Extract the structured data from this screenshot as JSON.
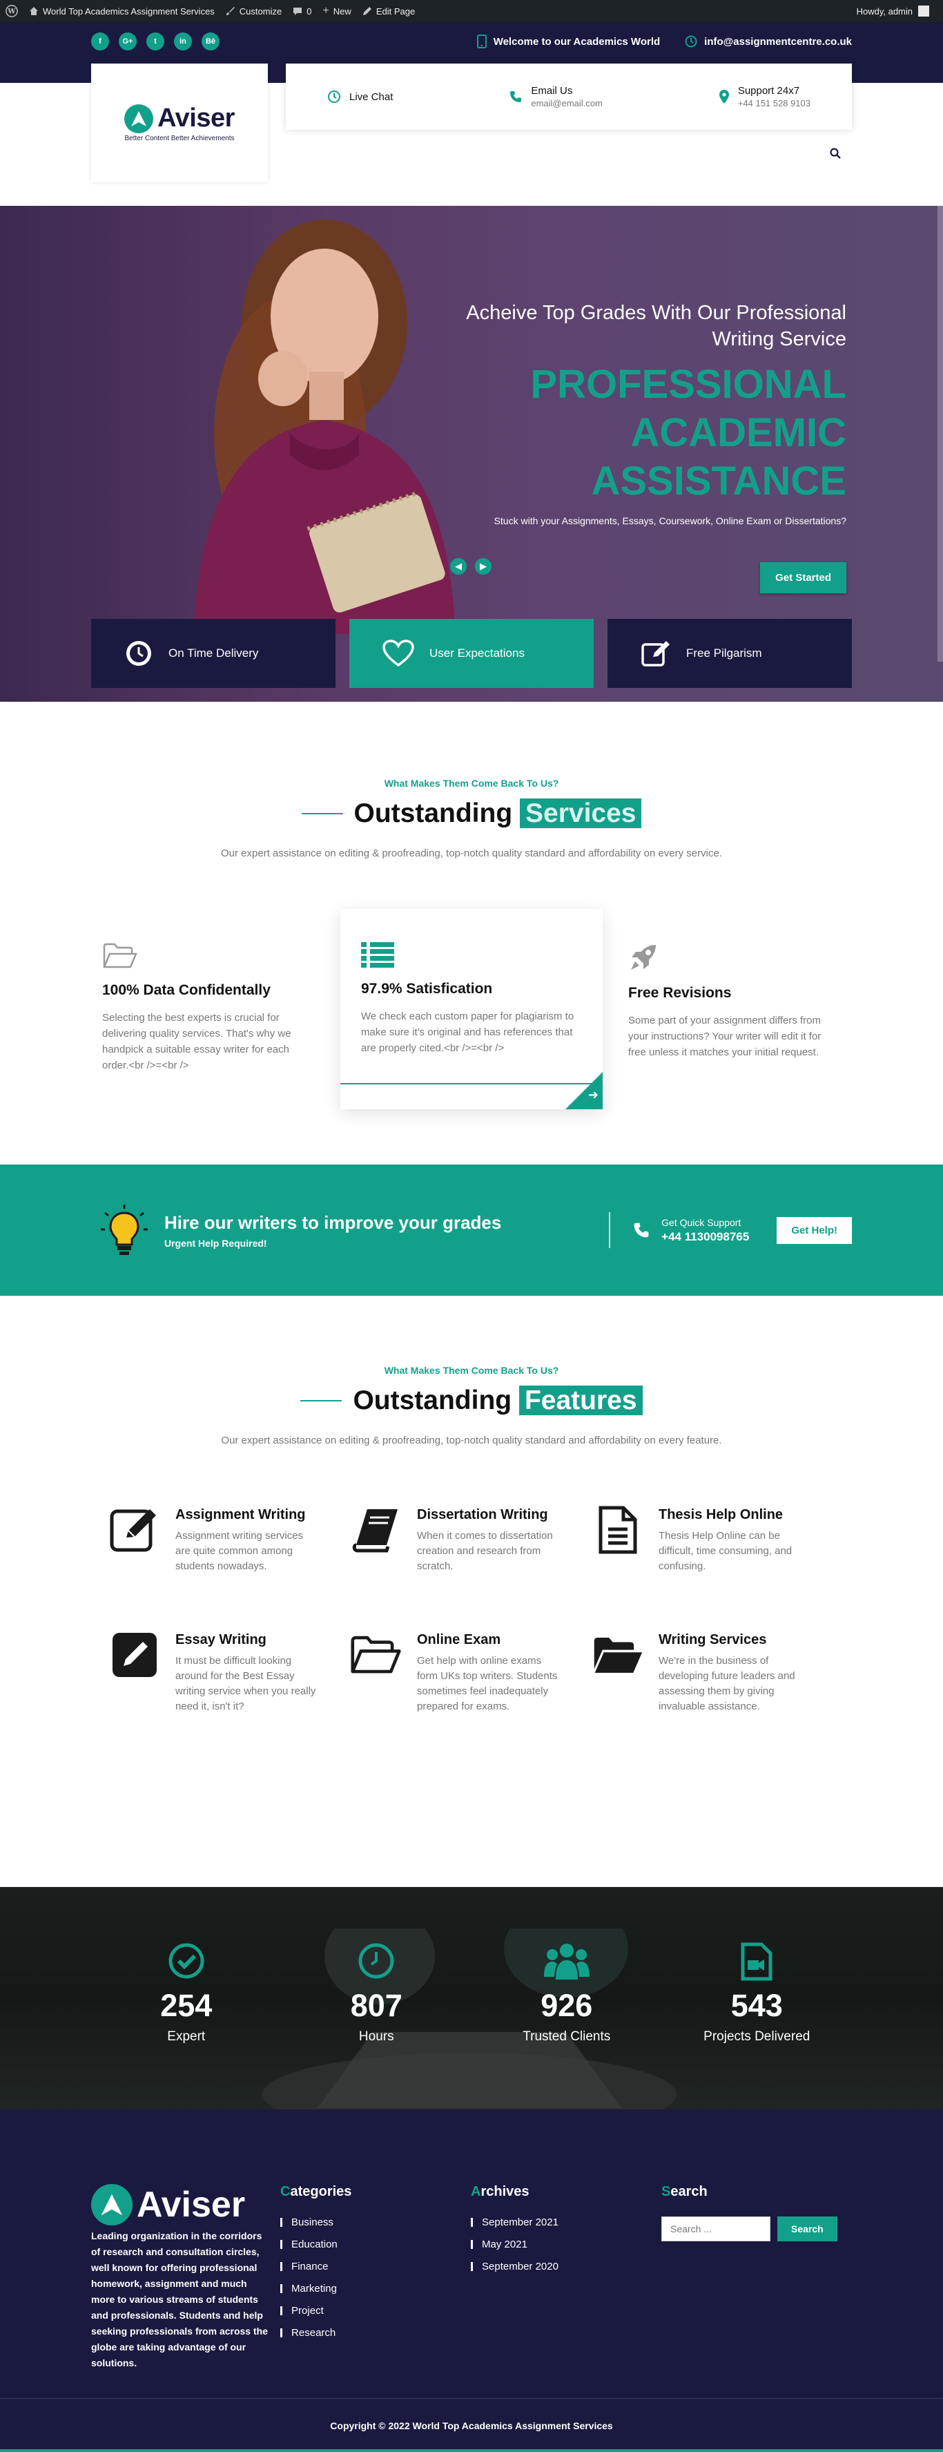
{
  "admin_bar": {
    "site_name": "World Top Academics Assignment Services",
    "customize": "Customize",
    "comments_count": "0",
    "new": "New",
    "edit_page": "Edit Page",
    "howdy": "Howdy, admin"
  },
  "topbar": {
    "socials": [
      "f",
      "G+",
      "t",
      "in",
      "Bē"
    ],
    "welcome": "Welcome to our Academics World",
    "email": "info@assignmentcentre.co.uk"
  },
  "header": {
    "logo_name": "Aviser",
    "logo_tagline": "Better Content Better Achievements",
    "live_chat": "Live Chat",
    "email_title": "Email Us",
    "email_value": "email@email.com",
    "support_title": "Support 24x7",
    "support_value": "+44 151 528 9103"
  },
  "hero": {
    "subtitle": "Acheive Top Grades With Our Professional Writing Service",
    "title_line1": "PROFESSIONAL",
    "title_line2": "ACADEMIC ASSISTANCE",
    "text": "Stuck with your Assignments, Essays, Coursework, Online Exam or Dissertations?",
    "button": "Get Started",
    "features": [
      "On Time Delivery",
      "User Expectations",
      "Free Pilgarism"
    ]
  },
  "services": {
    "eyebrow": "What Makes Them Come Back To Us?",
    "title": "Outstanding",
    "title_highlight": "Services",
    "description": "Our expert assistance on editing & proofreading, top-notch quality standard and affordability on every service.",
    "cards": [
      {
        "title": "100% Data Confidentally",
        "text": "Selecting the best experts is crucial for delivering quality services. That's why we handpick a suitable essay writer for each order.<br />=<br />"
      },
      {
        "title": "97.9% Satisfication",
        "text": "We check each custom paper for plagiarism to make sure it's original and has references that are properly cited.<br />=<br />"
      },
      {
        "title": "Free Revisions",
        "text": "Some part of your assignment differs from your instructions? Your writer will edit it for free unless it matches your initial request."
      }
    ]
  },
  "cta": {
    "title": "Hire our writers to improve your grades",
    "subtitle": "Urgent Help Required!",
    "support_label": "Get Quick Support",
    "phone": "+44 1130098765",
    "button": "Get Help!"
  },
  "features": {
    "eyebrow": "What Makes Them Come Back To Us?",
    "title": "Outstanding",
    "title_highlight": "Features",
    "description": "Our expert assistance on editing & proofreading, top-notch quality standard and affordability on every feature.",
    "items": [
      {
        "title": "Assignment Writing",
        "text": "Assignment writing services are quite common among students nowadays."
      },
      {
        "title": "Dissertation Writing",
        "text": "When it comes to dissertation creation and research from scratch."
      },
      {
        "title": "Thesis Help Online",
        "text": "Thesis Help Online can be difficult, time consuming, and confusing."
      },
      {
        "title": "Essay Writing",
        "text": "It must be difficult looking around for the Best Essay writing service when you really need it, isn't it?"
      },
      {
        "title": "Online Exam",
        "text": "Get help with online exams form UKs top writers. Students sometimes feel inadequately prepared for exams."
      },
      {
        "title": "Writing Services",
        "text": "We're in the business of developing future leaders and assessing them by giving invaluable assistance."
      }
    ]
  },
  "counters": [
    {
      "number": "254",
      "label": "Expert"
    },
    {
      "number": "807",
      "label": "Hours"
    },
    {
      "number": "926",
      "label": "Trusted Clients"
    },
    {
      "number": "543",
      "label": "Projects Delivered"
    }
  ],
  "footer": {
    "logo_name": "Aviser",
    "about": "Leading organization in the corridors of research and consultation circles, well known for offering professional homework, assignment and much more to various streams of students and professionals. Students and help seeking professionals from across the globe are taking advantage of our solutions.",
    "categories_title_first": "C",
    "categories_title_rest": "ategories",
    "categories": [
      "Business",
      "Education",
      "Finance",
      "Marketing",
      "Project",
      "Research"
    ],
    "archives_title_first": "A",
    "archives_title_rest": "rchives",
    "archives": [
      "September 2021",
      "May 2021",
      "September 2020"
    ],
    "search_title_first": "S",
    "search_title_rest": "earch",
    "search_placeholder": "Search ...",
    "search_button": "Search",
    "copyright": "Copyright © 2022 World Top Academics Assignment Services"
  },
  "colors": {
    "accent": "#13a08b",
    "navy": "#1a1a40"
  }
}
